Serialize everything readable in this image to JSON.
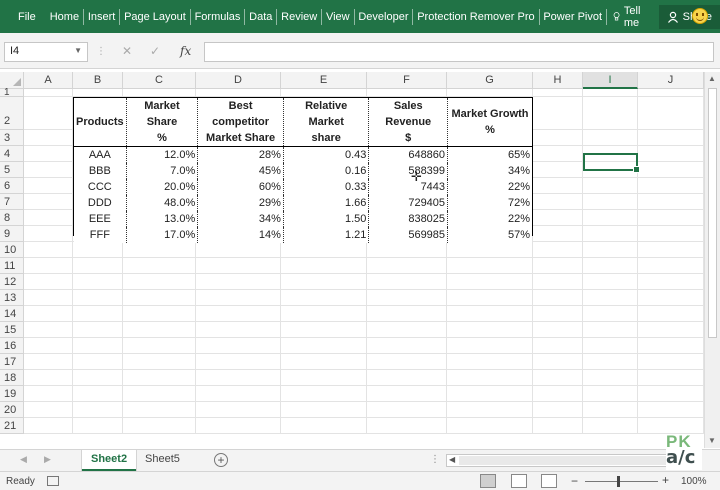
{
  "ribbon": {
    "tabs": [
      "File",
      "Home",
      "Insert",
      "Page Layout",
      "Formulas",
      "Data",
      "Review",
      "View",
      "Developer",
      "Protection Remover Pro",
      "Power Pivot"
    ],
    "tell_me": "Tell me",
    "share": "Share"
  },
  "formula_bar": {
    "name_box": "I4",
    "fx": "fx",
    "cancel": "✕",
    "enter": "✓",
    "content": ""
  },
  "columns": [
    "A",
    "B",
    "C",
    "D",
    "E",
    "F",
    "G",
    "H",
    "I",
    "J"
  ],
  "rows": [
    "1",
    "2",
    "3",
    "4",
    "5",
    "6",
    "7",
    "8",
    "9",
    "10",
    "11",
    "12",
    "13",
    "14",
    "15",
    "16",
    "17",
    "18",
    "19",
    "20",
    "21"
  ],
  "selected_cell": "I4",
  "table": {
    "headers": [
      [
        "Products",
        ""
      ],
      [
        "Market Share",
        "%"
      ],
      [
        "Best competitor",
        "Market Share"
      ],
      [
        "Relative Market",
        "share"
      ],
      [
        "Sales Revenue",
        "$"
      ],
      [
        "Market Growth",
        "%"
      ]
    ],
    "rows": [
      [
        "AAA",
        "12.0%",
        "28%",
        "0.43",
        "648860",
        "65%"
      ],
      [
        "BBB",
        "7.0%",
        "45%",
        "0.16",
        "588399",
        "34%"
      ],
      [
        "CCC",
        "20.0%",
        "60%",
        "0.33",
        "7443",
        "22%"
      ],
      [
        "DDD",
        "48.0%",
        "29%",
        "1.66",
        "729405",
        "72%"
      ],
      [
        "EEE",
        "13.0%",
        "34%",
        "1.50",
        "838025",
        "22%"
      ],
      [
        "FFF",
        "17.0%",
        "14%",
        "1.21",
        "569985",
        "57%"
      ]
    ]
  },
  "sheets": [
    {
      "name": "Sheet2",
      "active": true
    },
    {
      "name": "Sheet5",
      "active": false
    }
  ],
  "status": {
    "ready": "Ready",
    "zoom": "100%"
  },
  "watermark": {
    "line1": "PK",
    "line2": "a/c"
  },
  "colors": {
    "accent": "#217346"
  }
}
